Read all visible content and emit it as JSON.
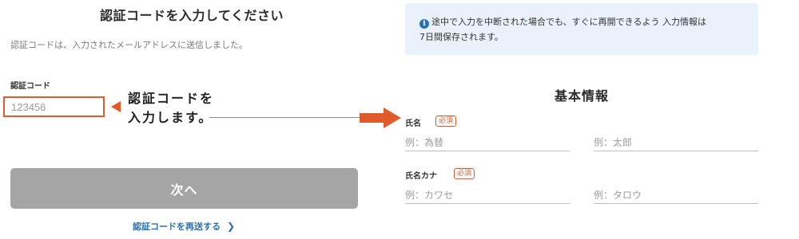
{
  "verification": {
    "title": "認証コードを入力してください",
    "description": "認証コードは、入力されたメールアドレスに送信しました。",
    "code_label": "認証コード",
    "code_placeholder": "123456",
    "callout_line1": "認証コードを",
    "callout_line2": "入力します。",
    "next_label": "次へ",
    "resend_label": "認証コードを再送する"
  },
  "notice": {
    "text": "途中で入力を中断された場合でも、すぐに再開できるよう 入力情報は",
    "text2": "7日間保存されます。"
  },
  "basic_info": {
    "title": "基本情報",
    "name_label": "氏名",
    "name_required": "必須",
    "last_name_placeholder": "例：為替",
    "first_name_placeholder": "例：太郎",
    "kana_label": "氏名カナ",
    "kana_required": "必須",
    "last_kana_placeholder": "例：カワセ",
    "first_kana_placeholder": "例：タロウ"
  },
  "colors": {
    "accent": "#e05a2b",
    "link": "#2c6fb4",
    "disabled_button": "#a5a5a5",
    "notice_bg": "#e9f2fb"
  },
  "icons": {
    "notice": "info-icon",
    "resend": "chevron-right-icon",
    "callout_left": "triangle-arrow-left-icon",
    "callout_right": "block-arrow-right-icon"
  }
}
